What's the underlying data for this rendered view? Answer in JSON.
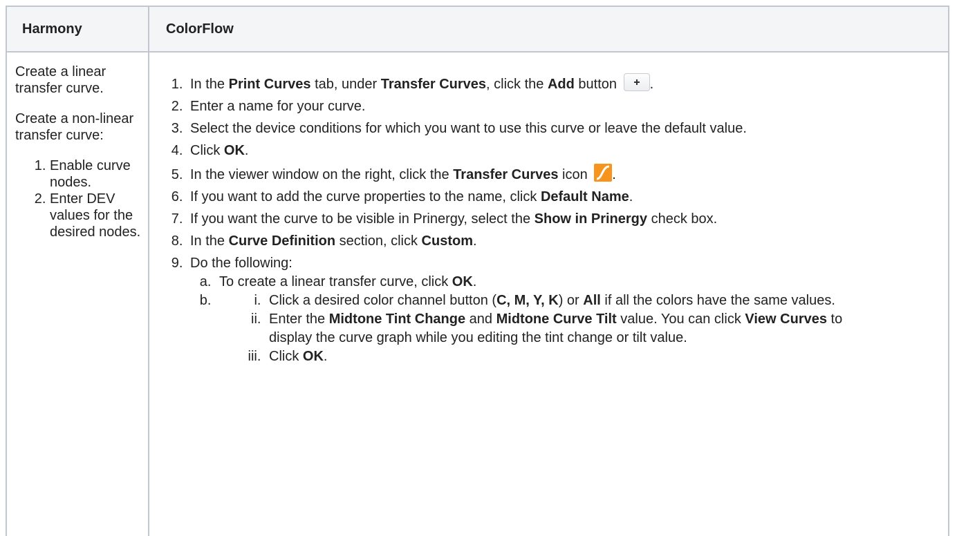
{
  "table": {
    "headers": [
      "Harmony",
      "ColorFlow"
    ],
    "harmony": {
      "para1": "Create a linear transfer curve.",
      "para2": "Create a non-linear transfer curve:",
      "steps": [
        "Enable curve nodes.",
        "Enter DEV values for the desired nodes."
      ]
    },
    "colorflow": {
      "s1": {
        "a": "In the ",
        "b": "Print Curves",
        "c": " tab, under ",
        "d": "Transfer Curves",
        "e": ", click the ",
        "f": "Add",
        "g": " button ",
        "h": "."
      },
      "s2": "Enter a name for your curve.",
      "s3": "Select the device conditions for which you want to use this curve or leave the default value.",
      "s4": {
        "a": "Click ",
        "b": "OK",
        "c": "."
      },
      "s5": {
        "a": "In the viewer window on the right, click the ",
        "b": "Transfer Curves",
        "c": " icon ",
        "d": "."
      },
      "s6": {
        "a": "If you want to add the curve properties to the name, click ",
        "b": "Default Name",
        "c": "."
      },
      "s7": {
        "a": "If you want the curve to be visible in Prinergy, select the ",
        "b": "Show in Prinergy",
        "c": " check box."
      },
      "s8": {
        "a": "In the ",
        "b": "Curve Definition",
        "c": " section, click ",
        "d": "Custom",
        "e": "."
      },
      "s9": {
        "text": "Do the following:",
        "a": {
          "a": "To create a linear transfer curve, click ",
          "b": "OK",
          "c": "."
        },
        "b_i": {
          "a": "Click a desired color channel button (",
          "b": "C, M, Y, K",
          "c": ") or ",
          "d": "All",
          "e": " if all the colors have the same values."
        },
        "b_ii": {
          "a": "Enter the ",
          "b": "Midtone Tint Change",
          "c": " and ",
          "d": "Midtone Curve Tilt",
          "e": " value. You can click ",
          "f": "View Curves",
          "g": " to display the curve graph while you editing the tint change or tilt value."
        },
        "b_iii": {
          "a": "Click ",
          "b": "OK",
          "c": "."
        }
      }
    }
  },
  "icons": {
    "add": "plus-icon",
    "transfer_curves": "transfer-curve-icon",
    "transfer_curves_color": "#f7941d"
  }
}
